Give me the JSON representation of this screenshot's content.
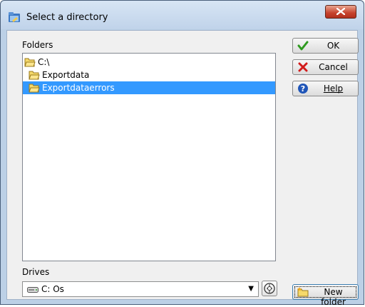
{
  "window": {
    "title": "Select a directory"
  },
  "folders": {
    "label": "Folders",
    "items": [
      {
        "label": "C:\\",
        "selected": false
      },
      {
        "label": "Exportdata",
        "selected": false
      },
      {
        "label": "Exportdataerrors",
        "selected": true
      }
    ]
  },
  "drives": {
    "label": "Drives",
    "selected": "C: Os"
  },
  "buttons": {
    "ok": "OK",
    "cancel": "Cancel",
    "help": "Help",
    "new_folder": "New folder"
  },
  "colors": {
    "selection": "#3399ff",
    "ok_check": "#2e9a1f",
    "cancel_x": "#d21b1b",
    "help_blue": "#1f55b8",
    "close_red": "#c6422d"
  }
}
